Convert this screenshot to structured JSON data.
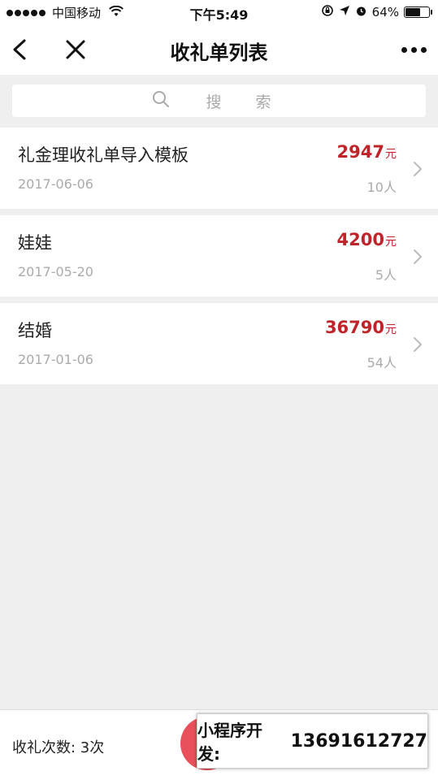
{
  "status_bar": {
    "carrier": "中国移动",
    "time": "下午5:49",
    "battery": "64%",
    "battery_level": 0.64
  },
  "nav": {
    "title": "收礼单列表"
  },
  "search": {
    "placeholder": "搜 索"
  },
  "items": [
    {
      "name": "礼金理收礼单导入模板",
      "date": "2017-06-06",
      "amount": "2947",
      "unit": "元",
      "count": "10人"
    },
    {
      "name": "娃娃",
      "date": "2017-05-20",
      "amount": "4200",
      "unit": "元",
      "count": "5人"
    },
    {
      "name": "结婚",
      "date": "2017-01-06",
      "amount": "36790",
      "unit": "元",
      "count": "54人"
    }
  ],
  "bottom": {
    "count_label": "收礼次数: 3次"
  },
  "overlay": {
    "label": "小程序开发:",
    "phone": "13691612727"
  },
  "colors": {
    "accent_red": "#c0242b",
    "fab": "#e8505b",
    "background": "#efefef"
  },
  "icons": [
    "wifi-icon",
    "lock-rotation-icon",
    "location-icon",
    "alarm-icon",
    "battery-icon",
    "back-arrow-icon",
    "close-icon",
    "more-icon",
    "search-icon",
    "chevron-right-icon"
  ]
}
